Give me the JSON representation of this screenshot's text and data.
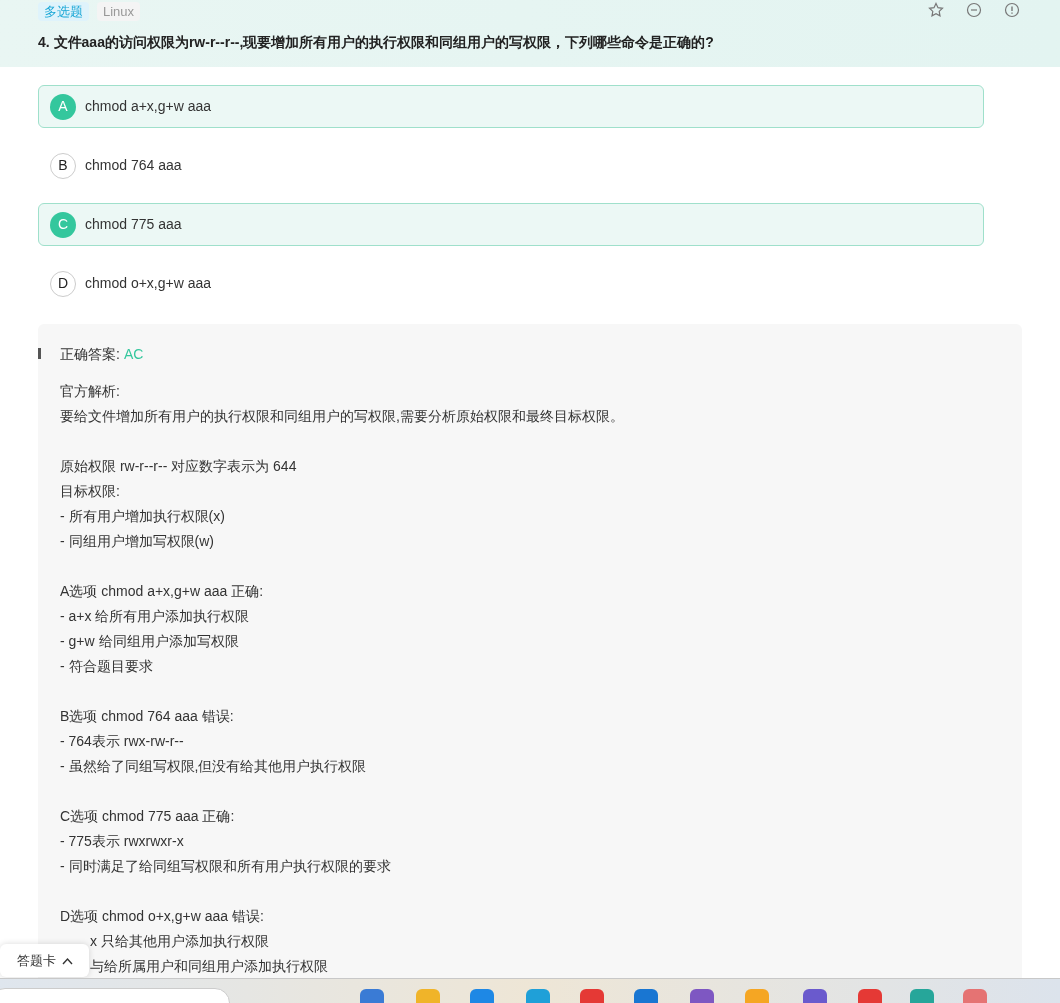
{
  "tags": [
    {
      "label": "多选题",
      "kind": "type"
    },
    {
      "label": "Linux",
      "kind": "topic"
    }
  ],
  "question": "4. 文件aaa的访问权限为rw-r--r--,现要增加所有用户的执行权限和同组用户的写权限，下列哪些命令是正确的?",
  "options": [
    {
      "letter": "A",
      "text": "chmod a+x,g+w aaa",
      "selected": true
    },
    {
      "letter": "B",
      "text": "chmod 764 aaa",
      "selected": false
    },
    {
      "letter": "C",
      "text": "chmod 775 aaa",
      "selected": true
    },
    {
      "letter": "D",
      "text": "chmod o+x,g+w aaa",
      "selected": false
    }
  ],
  "answer": {
    "label": "正确答案:",
    "value": "AC"
  },
  "explanation": [
    [
      "官方解析:",
      "要给文件增加所有用户的执行权限和同组用户的写权限,需要分析原始权限和最终目标权限。"
    ],
    [
      "原始权限 rw-r--r-- 对应数字表示为 644",
      "目标权限:",
      "- 所有用户增加执行权限(x)",
      "- 同组用户增加写权限(w)"
    ],
    [
      "A选项 chmod a+x,g+w aaa 正确:",
      "- a+x 给所有用户添加执行权限",
      "- g+w 给同组用户添加写权限",
      "- 符合题目要求"
    ],
    [
      "B选项 chmod 764 aaa 错误:",
      "- 764表示 rwx-rw-r--",
      "- 虽然给了同组写权限,但没有给其他用户执行权限"
    ],
    [
      "C选项 chmod 775 aaa 正确:",
      "- 775表示 rwxrwxr-x",
      "- 同时满足了给同组写权限和所有用户执行权限的要求"
    ],
    [
      "D选项 chmod o+x,g+w aaa 错误:",
      "x 只给其他用户添加执行权限",
      "与给所属用户和同组用户添加执行权限"
    ]
  ],
  "answer_card": {
    "label": "答题卡"
  }
}
